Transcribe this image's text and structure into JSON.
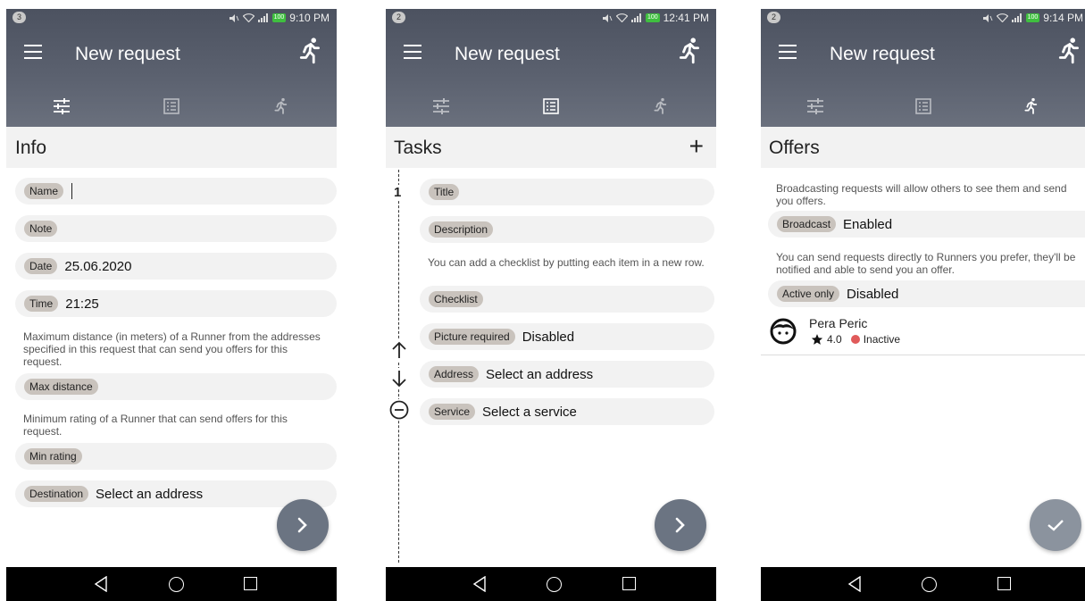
{
  "phones": [
    {
      "status": {
        "badge": "3",
        "battery": "100",
        "time": "9:10 PM"
      },
      "title": "New request",
      "section_title": "Info",
      "fields": {
        "name_label": "Name",
        "note_label": "Note",
        "date_label": "Date",
        "date_value": "25.06.2020",
        "time_label": "Time",
        "time_value": "21:25",
        "max_distance_hint": "Maximum distance (in meters) of a Runner from the addresses specified in this request that can send you offers for this request.",
        "max_distance_label": "Max distance",
        "min_rating_hint": "Minimum rating of a Runner that can send offers for this request.",
        "min_rating_label": "Min rating",
        "destination_label": "Destination",
        "destination_value": "Select an address"
      },
      "active_tab": "info"
    },
    {
      "status": {
        "badge": "2",
        "battery": "100",
        "time": "12:41 PM"
      },
      "title": "New request",
      "section_title": "Tasks",
      "task_number": "1",
      "fields": {
        "title_label": "Title",
        "description_label": "Description",
        "checklist_hint": "You can add a checklist by putting each item in a new row.",
        "checklist_label": "Checklist",
        "picture_label": "Picture required",
        "picture_value": "Disabled",
        "address_label": "Address",
        "address_value": "Select an address",
        "service_label": "Service",
        "service_value": "Select a service"
      },
      "active_tab": "tasks"
    },
    {
      "status": {
        "badge": "2",
        "battery": "100",
        "time": "9:14 PM"
      },
      "title": "New request",
      "section_title": "Offers",
      "fields": {
        "broadcast_hint": "Broadcasting requests will allow others to see them and send you offers.",
        "broadcast_label": "Broadcast",
        "broadcast_value": "Enabled",
        "runners_hint": "You can send requests directly to Runners you prefer, they'll be notified and able to send you an offer.",
        "active_only_label": "Active only",
        "active_only_value": "Disabled"
      },
      "runner": {
        "name": "Pera Peric",
        "rating": "4.0",
        "status": "Inactive"
      },
      "active_tab": "offers"
    }
  ],
  "colors": {
    "header": "#5c6270",
    "field_bg": "#f2f2f2",
    "chip_bg": "#c9c3bd",
    "fab": "#6b7482",
    "inactive_dot": "#e05a5a",
    "battery": "#3fbf3f"
  },
  "icons": {
    "menu": "hamburger-icon",
    "runner": "runner-icon",
    "tab_info": "sliders-icon",
    "tab_tasks": "list-icon",
    "tab_offers": "runner-icon",
    "next": "chevron-right-icon",
    "done": "check-icon"
  }
}
